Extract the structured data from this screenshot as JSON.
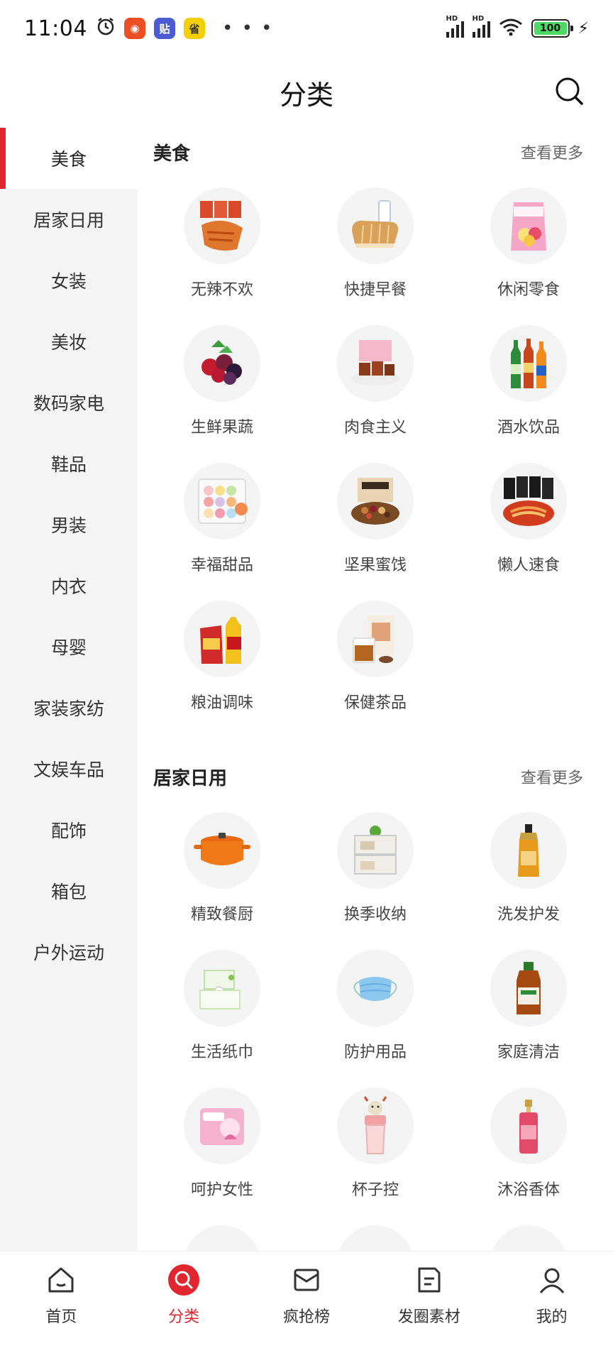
{
  "status_bar": {
    "time": "11:04",
    "alarm_icon": "alarm-icon",
    "app_badges": [
      {
        "name": "lion-app-icon",
        "text": "◉",
        "color": "#f04e23"
      },
      {
        "name": "tieba-app-icon",
        "text": "贴",
        "color": "#4a5bd4"
      },
      {
        "name": "taobao-app-icon",
        "text": "省",
        "color": "#f5d000"
      }
    ],
    "more": "• • •",
    "signal_label": "HD",
    "battery": "100"
  },
  "header": {
    "title": "分类",
    "search_icon": "search-icon"
  },
  "sidebar": {
    "items": [
      {
        "label": "美食",
        "active": true
      },
      {
        "label": "居家日用"
      },
      {
        "label": "女装"
      },
      {
        "label": "美妆"
      },
      {
        "label": "数码家电"
      },
      {
        "label": "鞋品"
      },
      {
        "label": "男装"
      },
      {
        "label": "内衣"
      },
      {
        "label": "母婴"
      },
      {
        "label": "家装家纺"
      },
      {
        "label": "文娱车品"
      },
      {
        "label": "配饰"
      },
      {
        "label": "箱包"
      },
      {
        "label": "户外运动"
      }
    ]
  },
  "sections": [
    {
      "title": "美食",
      "more": "查看更多",
      "items": [
        {
          "label": "无辣不欢",
          "icon": "spicy-snack-icon"
        },
        {
          "label": "快捷早餐",
          "icon": "bread-icon"
        },
        {
          "label": "休闲零食",
          "icon": "snack-bag-icon"
        },
        {
          "label": "生鲜果蔬",
          "icon": "berries-icon"
        },
        {
          "label": "肉食主义",
          "icon": "meat-icon"
        },
        {
          "label": "酒水饮品",
          "icon": "bottles-icon"
        },
        {
          "label": "幸福甜品",
          "icon": "macaron-icon"
        },
        {
          "label": "坚果蜜饯",
          "icon": "nuts-icon"
        },
        {
          "label": "懒人速食",
          "icon": "noodles-icon"
        },
        {
          "label": "粮油调味",
          "icon": "oil-rice-icon"
        },
        {
          "label": "保健茶品",
          "icon": "tea-icon"
        }
      ]
    },
    {
      "title": "居家日用",
      "more": "查看更多",
      "items": [
        {
          "label": "精致餐厨",
          "icon": "pot-icon"
        },
        {
          "label": "换季收纳",
          "icon": "storage-box-icon"
        },
        {
          "label": "洗发护发",
          "icon": "shampoo-icon"
        },
        {
          "label": "生活纸巾",
          "icon": "tissue-icon"
        },
        {
          "label": "防护用品",
          "icon": "mask-icon"
        },
        {
          "label": "家庭清洁",
          "icon": "cleaner-bottle-icon"
        },
        {
          "label": "呵护女性",
          "icon": "sanitary-pad-icon"
        },
        {
          "label": "杯子控",
          "icon": "cup-icon"
        },
        {
          "label": "沐浴香体",
          "icon": "body-mist-icon"
        }
      ]
    }
  ],
  "tabbar": {
    "tabs": [
      {
        "label": "首页",
        "icon": "home-icon"
      },
      {
        "label": "分类",
        "icon": "category-search-icon",
        "active": true
      },
      {
        "label": "疯抢榜",
        "icon": "ranking-icon"
      },
      {
        "label": "发圈素材",
        "icon": "document-icon"
      },
      {
        "label": "我的",
        "icon": "user-icon"
      }
    ]
  },
  "colors": {
    "accent": "#e0262f",
    "sidebar_bg": "#f5f5f5"
  }
}
